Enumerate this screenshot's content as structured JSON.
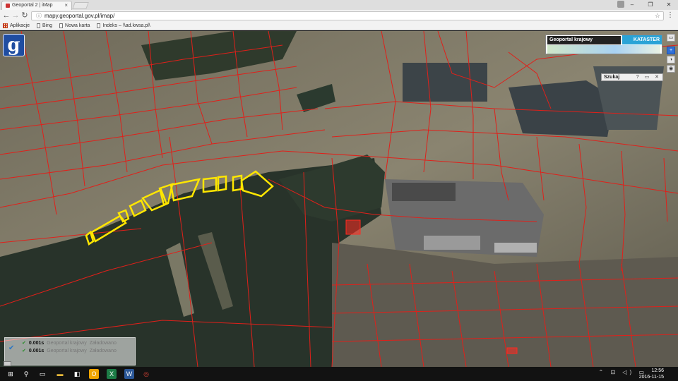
{
  "browser": {
    "tab_title": "Geoportal 2 | iMap",
    "tab_close": "×",
    "window_controls": [
      "–",
      "❐",
      "✕"
    ],
    "url": "mapy.geoportal.gov.pl/imap/",
    "nav": [
      "←",
      "→",
      "↻"
    ],
    "bookmarks": [
      {
        "label": "Aplikacje",
        "icon": "apps-icon"
      },
      {
        "label": "Bing",
        "icon": "page-icon"
      },
      {
        "label": "Nowa karta",
        "icon": "page-icon"
      },
      {
        "label": "Indeks – \\\\ad.kwsa.pl\\",
        "icon": "page-icon"
      }
    ]
  },
  "app": {
    "logo_letter": "g",
    "portal_title": "Geoportal krajowy",
    "portal_badge": "KATASTER",
    "search_panel_title": "Szukaj",
    "search_panel_icons": "? ▭ ✕",
    "side_buttons": [
      "▭",
      "+",
      "◑",
      "◉"
    ]
  },
  "status": {
    "rows": [
      {
        "time": "0.001s",
        "service": "Geoportal krajowy",
        "state": "Załadowano"
      },
      {
        "time": "0.001s",
        "service": "Geoportal krajowy",
        "state": "Załadowano"
      }
    ]
  },
  "taskbar": {
    "icons": [
      {
        "name": "start-icon",
        "glyph": "⊞",
        "color": "#ffffff"
      },
      {
        "name": "search-icon",
        "glyph": "⚲",
        "color": "#ffffff"
      },
      {
        "name": "task-view-icon",
        "glyph": "▭",
        "color": "#ffffff"
      },
      {
        "name": "file-explorer-icon",
        "glyph": "▬",
        "color": "#e6b73a"
      },
      {
        "name": "store-icon",
        "glyph": "◧",
        "color": "#ffffff"
      },
      {
        "name": "outlook-icon",
        "glyph": "O",
        "color": "#f0a500"
      },
      {
        "name": "excel-icon",
        "glyph": "X",
        "color": "#1d7b46"
      },
      {
        "name": "word-icon",
        "glyph": "W",
        "color": "#2b5797"
      },
      {
        "name": "chrome-icon",
        "glyph": "◎",
        "color": "#db4437"
      }
    ],
    "tray": "⌃ ⊡ ◁) ▭",
    "time": "12:56",
    "date": "2016-11-15"
  }
}
